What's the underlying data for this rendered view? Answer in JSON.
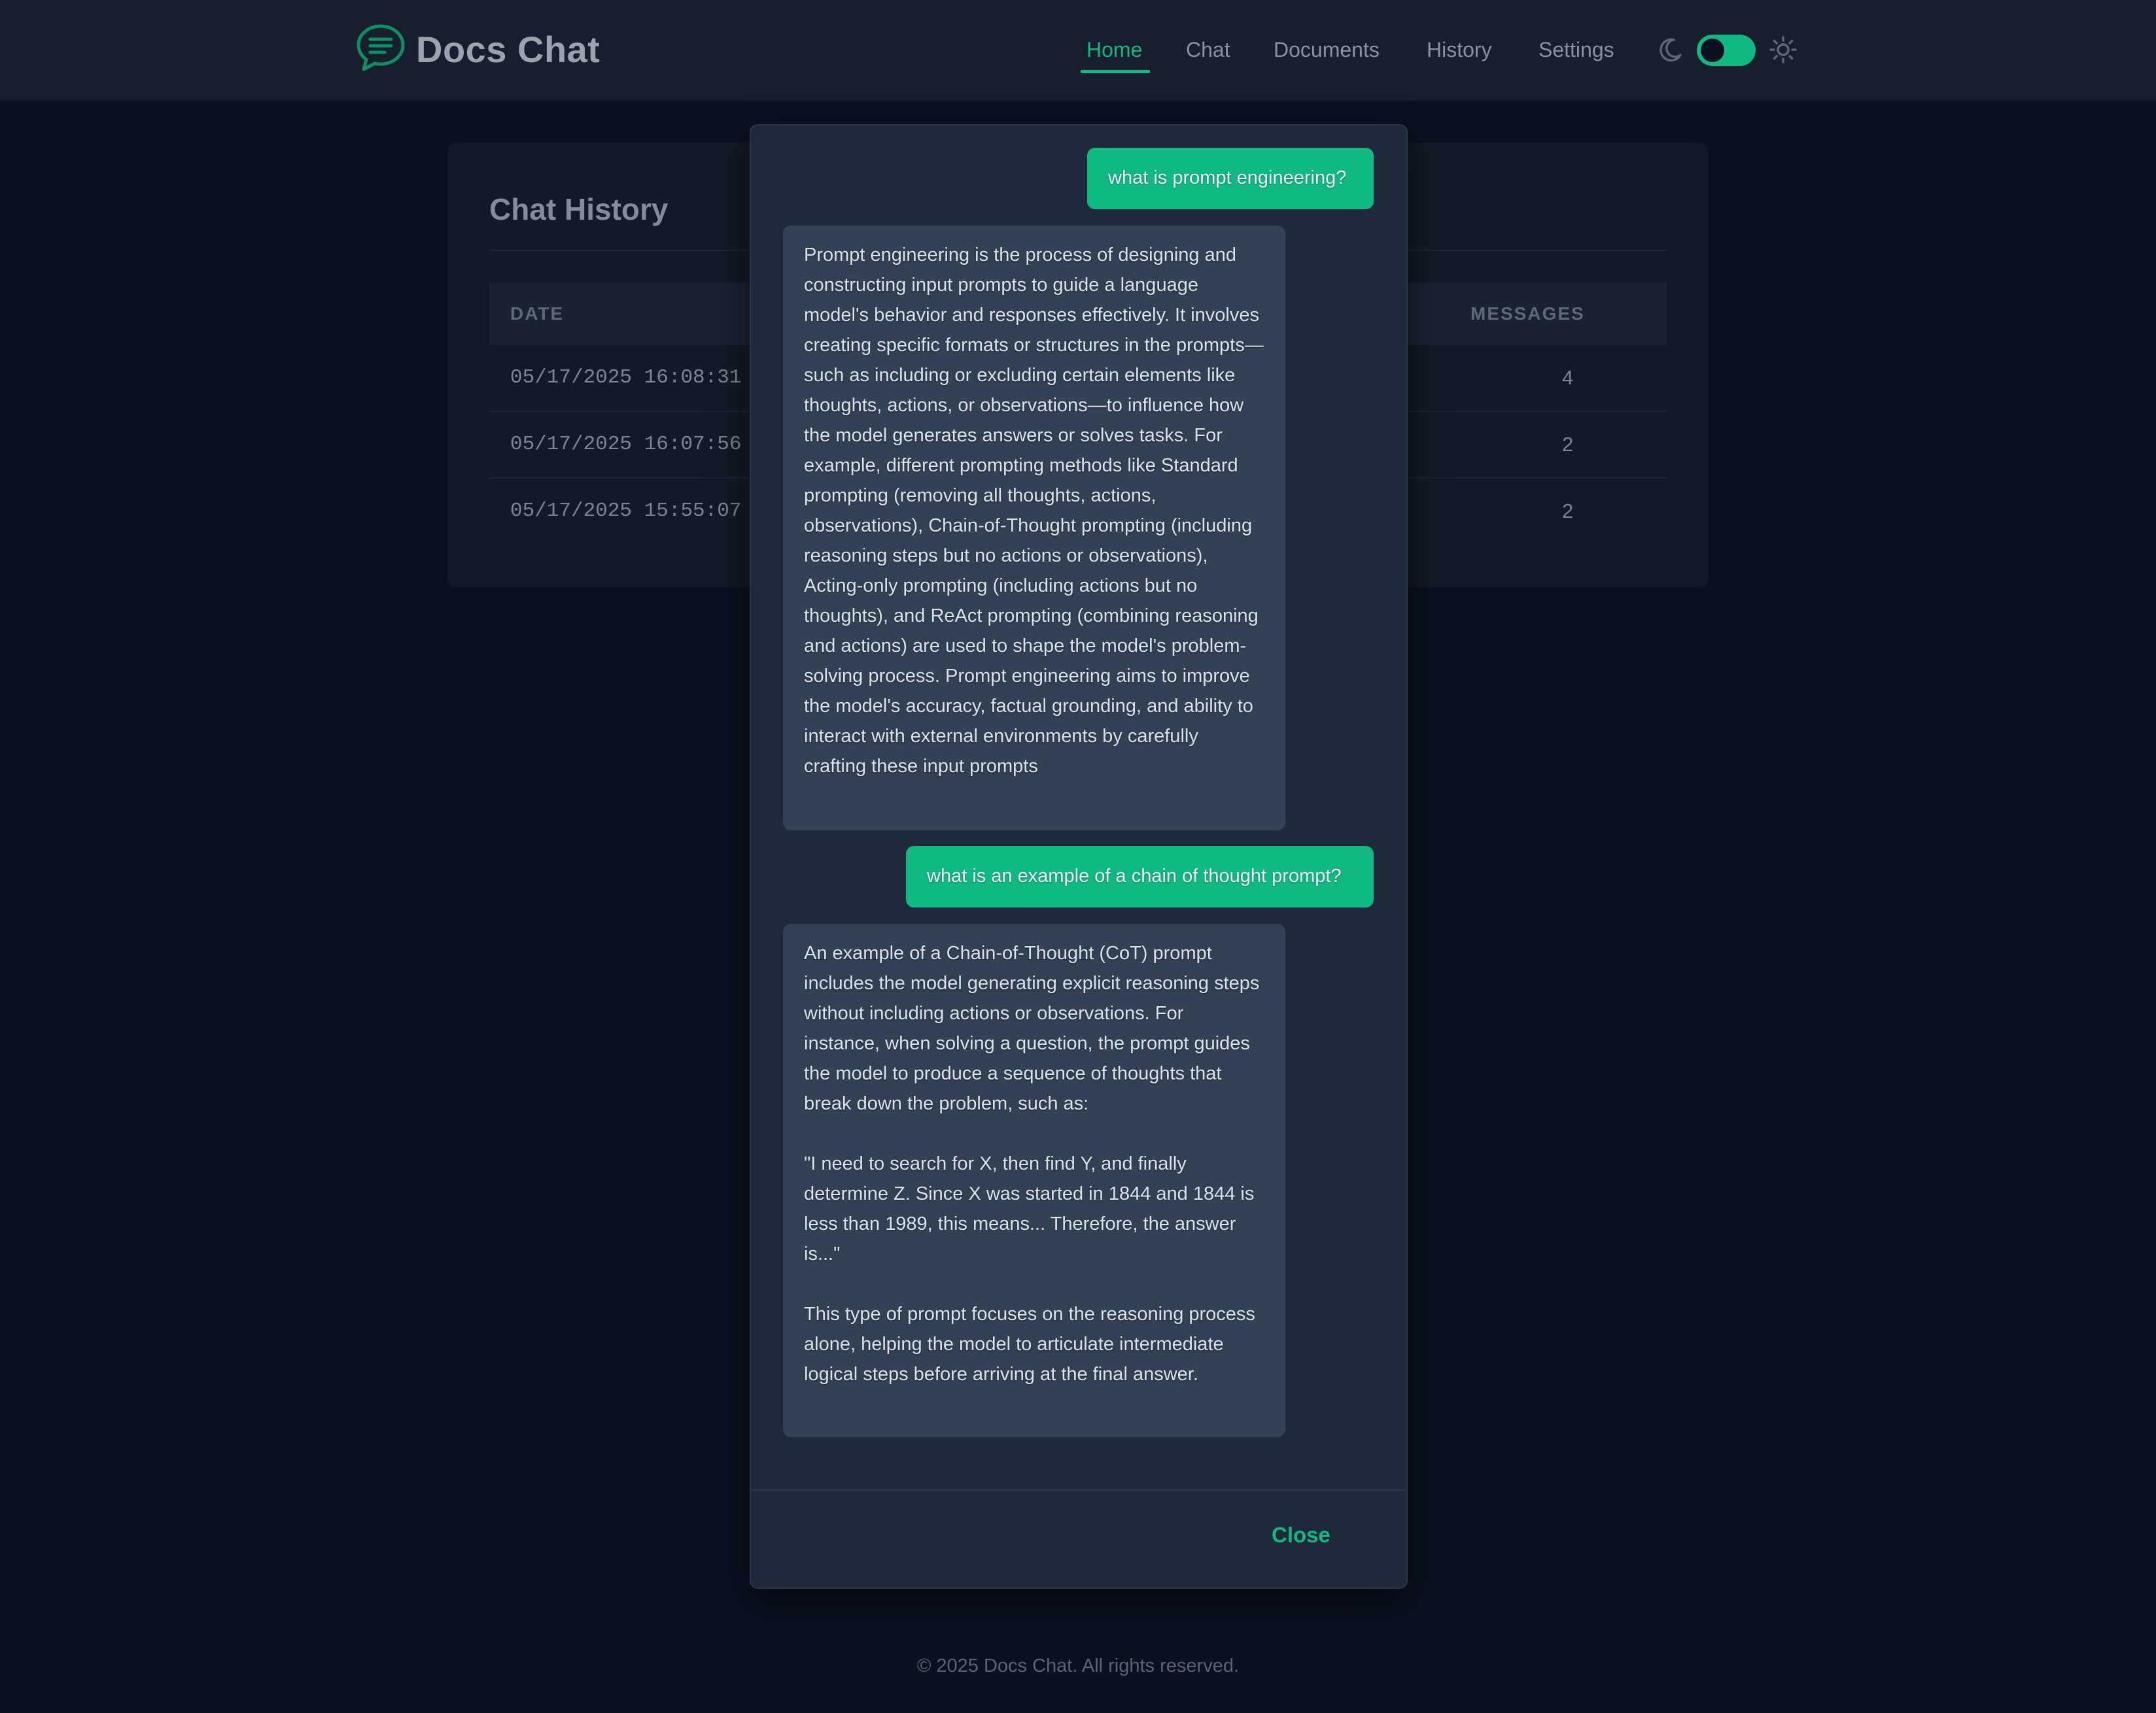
{
  "header": {
    "brand": "Docs Chat",
    "nav": [
      {
        "label": "Home",
        "active": true
      },
      {
        "label": "Chat",
        "active": false
      },
      {
        "label": "Documents",
        "active": false
      },
      {
        "label": "History",
        "active": false
      },
      {
        "label": "Settings",
        "active": false
      }
    ],
    "theme_toggle": {
      "dark_icon": "moon-icon",
      "light_icon": "sun-icon",
      "state": "on"
    }
  },
  "history": {
    "title": "Chat History",
    "columns": [
      "DATE",
      "MESSAGES"
    ],
    "rows": [
      {
        "date": "05/17/2025 16:08:31",
        "messages": "4"
      },
      {
        "date": "05/17/2025 16:07:56",
        "messages": "2"
      },
      {
        "date": "05/17/2025 15:55:07",
        "messages": "2"
      }
    ]
  },
  "modal": {
    "messages": [
      {
        "role": "user",
        "text": "what is prompt engineering?"
      },
      {
        "role": "assistant",
        "paragraphs": [
          "Prompt engineering is the process of designing and constructing input prompts to guide a language model's behavior and responses effectively. It involves creating specific formats or structures in the prompts—such as including or excluding certain elements like thoughts, actions, or observations—to influence how the model generates answers or solves tasks. For example, different prompting methods like Standard prompting (removing all thoughts, actions, observations), Chain-of-Thought prompting (including reasoning steps but no actions or observations), Acting-only prompting (including actions but no thoughts), and ReAct prompting (combining reasoning and actions) are used to shape the model's problem-solving process. Prompt engineering aims to improve the model's accuracy, factual grounding, and ability to interact with external environments by carefully crafting these input prompts"
        ]
      },
      {
        "role": "user",
        "text": "what is an example of a chain of thought prompt?"
      },
      {
        "role": "assistant",
        "paragraphs": [
          "An example of a Chain-of-Thought (CoT) prompt includes the model generating explicit reasoning steps without including actions or observations. For instance, when solving a question, the prompt guides the model to produce a sequence of thoughts that break down the problem, such as:",
          "\"I need to search for X, then find Y, and finally determine Z. Since X was started in 1844 and 1844 is less than 1989, this means... Therefore, the answer is...\"",
          "This type of prompt focuses on the reasoning process alone, helping the model to articulate intermediate logical steps before arriving at the final answer."
        ]
      }
    ],
    "close_label": "Close"
  },
  "footer": {
    "text": "© 2025 Docs Chat. All rights reserved."
  },
  "colors": {
    "accent": "#10b981",
    "page_bg": "#0b1120",
    "modal_bg": "#1e2a3b",
    "assistant_bubble": "#334155"
  }
}
